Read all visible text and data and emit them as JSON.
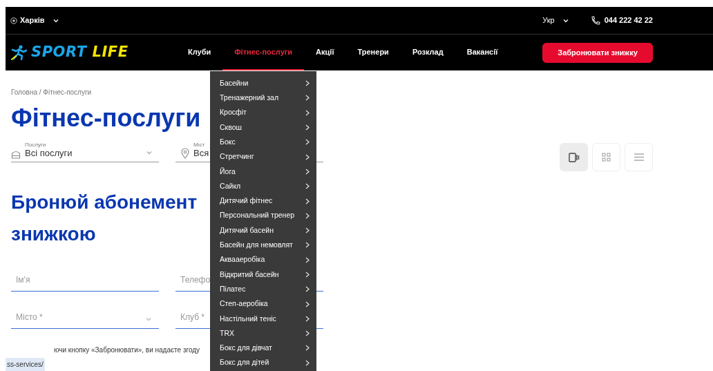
{
  "top_bar": {
    "city": "Харків",
    "language": "Укр",
    "phone": "044 222 42 22"
  },
  "logo": {
    "part_1": "SPORT",
    "part_2": "LIFE"
  },
  "nav": [
    {
      "label": "Клуби",
      "selected": false
    },
    {
      "label": "Фітнес-послуги",
      "selected": true
    },
    {
      "label": "Акції",
      "selected": false
    },
    {
      "label": "Тренери",
      "selected": false
    },
    {
      "label": "Розклад",
      "selected": false
    },
    {
      "label": "Вакансії",
      "selected": false
    }
  ],
  "cta_button": "Забронювати знижку",
  "dropdown": [
    "Басейни",
    "Тренажерний зал",
    "Кросфіт",
    "Сквош",
    "Бокс",
    "Стретчинг",
    "Йога",
    "Сайкл",
    "Дитячий фітнес",
    "Персональний тренер",
    "Дитячий басейн",
    "Басейн для немовлят",
    "Аквааеробіка",
    "Відкритий басейн",
    "Пілатес",
    "Степ-аеробіка",
    "Настільний теніс",
    "TRX",
    "Бокс для дівчат",
    "Бокс для дітей"
  ],
  "breadcrumb": "Головна / Фітнес-послуги",
  "title": "Фітнес-послуги",
  "filters": [
    {
      "label": "Послуги",
      "value": "Всі послуги",
      "kind": "service"
    },
    {
      "label": "Міст",
      "value": "Вся",
      "kind": "location"
    }
  ],
  "view_toggles": [
    {
      "kind": "slider",
      "selected": true
    },
    {
      "kind": "grid",
      "selected": false
    },
    {
      "kind": "list",
      "selected": false
    }
  ],
  "form": {
    "heading_line_1": "Бронюй абонемент",
    "heading_line_2": "знижкою",
    "fields": [
      {
        "placeholder": "Ім'я",
        "kind": "text"
      },
      {
        "placeholder": "Телефо",
        "kind": "text"
      },
      {
        "placeholder": "Місто *",
        "kind": "select"
      },
      {
        "placeholder": "Клуб *",
        "kind": "text"
      }
    ],
    "consent": "ючи кнопку «Забронювати», ви надаєте згоду"
  },
  "link_preview": "ss-services/"
}
